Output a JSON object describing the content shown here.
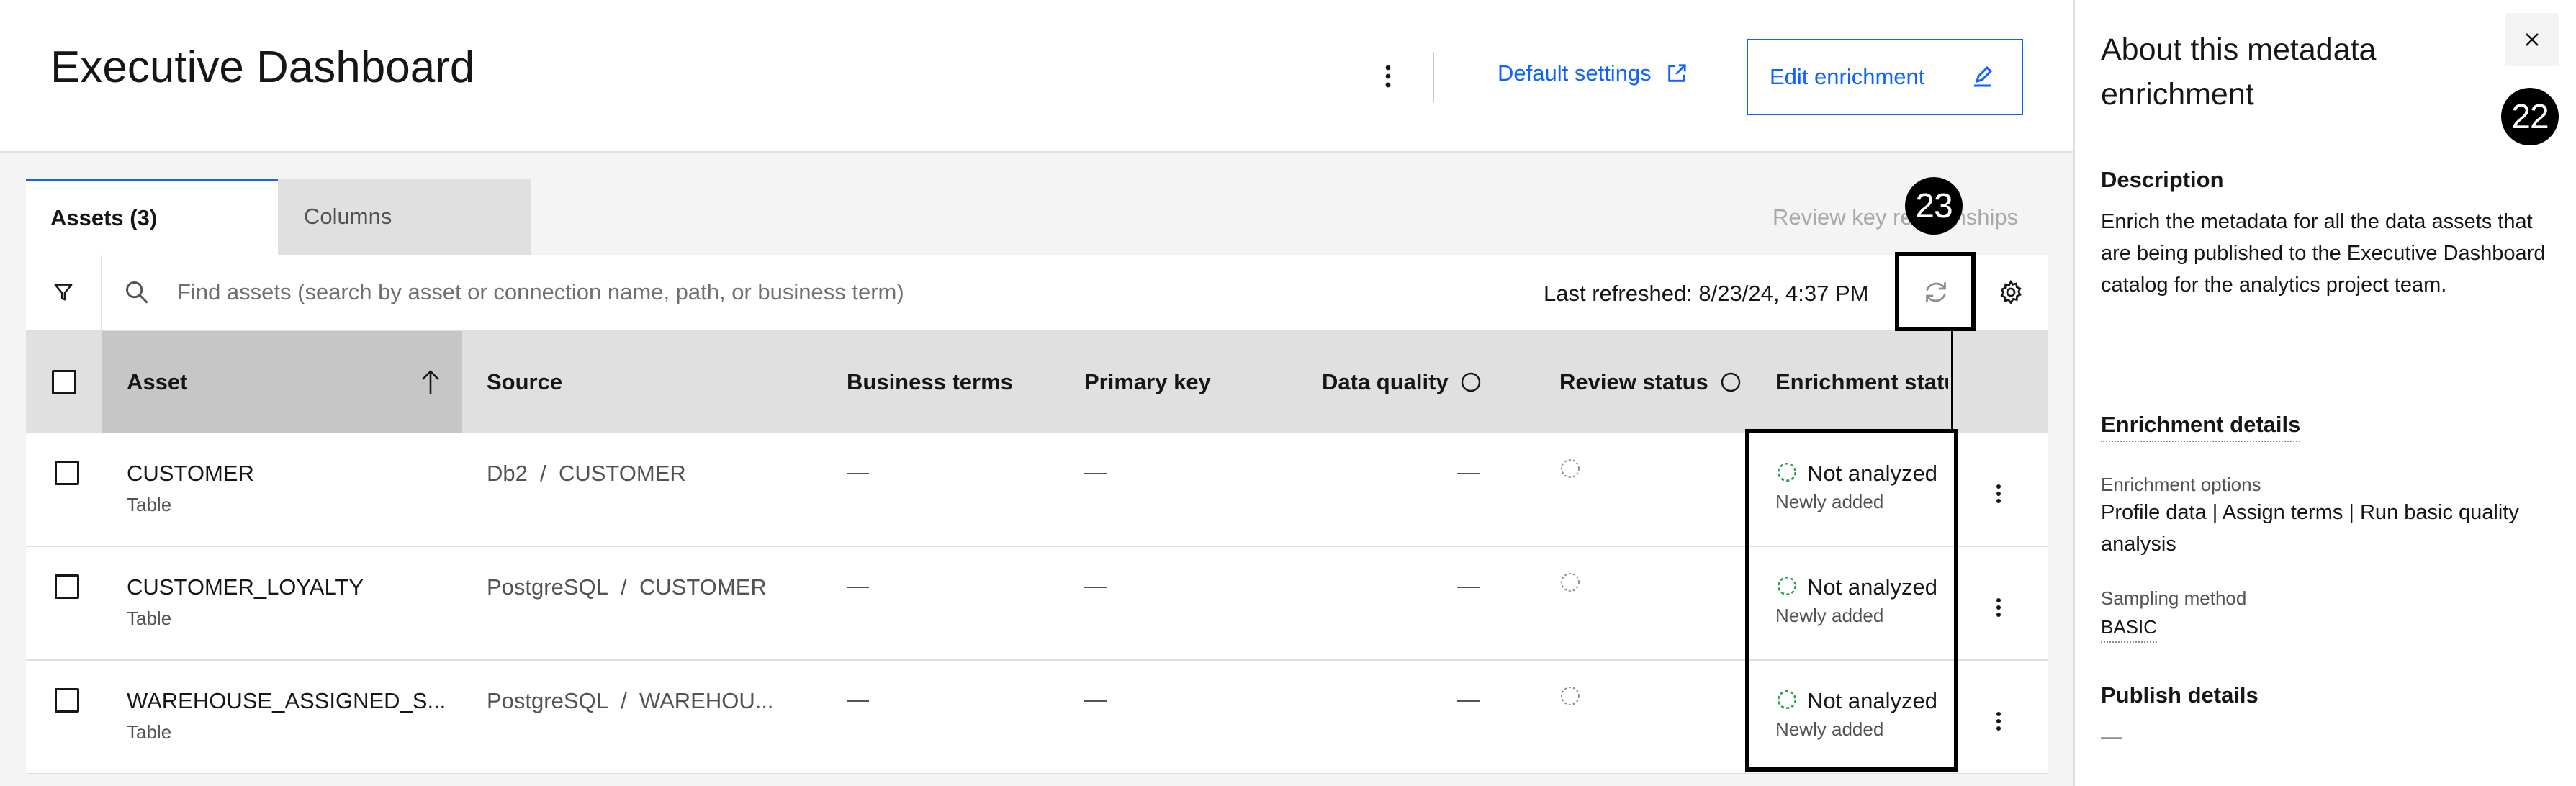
{
  "page": {
    "title": "Executive Dashboard",
    "default_settings_label": "Default settings",
    "edit_enrichment_label": "Edit enrichment"
  },
  "tabs": [
    {
      "label": "Assets (3)",
      "selected": true
    },
    {
      "label": "Columns",
      "selected": false
    }
  ],
  "review_key_relationships_label": "Review key relationships",
  "toolbar": {
    "search_placeholder": "Find assets (search by asset or connection name, path, or business term)",
    "last_refreshed": "Last refreshed: 8/23/24, 4:37 PM"
  },
  "table": {
    "headers": {
      "asset": "Asset",
      "source": "Source",
      "business_terms": "Business terms",
      "primary_key": "Primary key",
      "data_quality": "Data quality",
      "review_status": "Review status",
      "enrichment_status": "Enrichment status"
    },
    "sort": {
      "column": "Asset",
      "direction": "ascending"
    },
    "rows": [
      {
        "name": "CUSTOMER",
        "type": "Table",
        "source_connection": "Db2",
        "source_path": "CUSTOMER",
        "business_terms": "—",
        "primary_key": "—",
        "data_quality": "—",
        "status": "Not analyzed",
        "status_sub": "Newly added"
      },
      {
        "name": "CUSTOMER_LOYALTY",
        "type": "Table",
        "source_connection": "PostgreSQL",
        "source_path": "CUSTOMER",
        "business_terms": "—",
        "primary_key": "—",
        "data_quality": "—",
        "status": "Not analyzed",
        "status_sub": "Newly added"
      },
      {
        "name": "WAREHOUSE_ASSIGNED_S...",
        "type": "Table",
        "source_connection": "PostgreSQL",
        "source_path": "WAREHOU...",
        "business_terms": "—",
        "primary_key": "—",
        "data_quality": "—",
        "status": "Not analyzed",
        "status_sub": "Newly added"
      }
    ],
    "source_separator": "/"
  },
  "annotations": {
    "refresh_badge": "23",
    "panel_badge": "22"
  },
  "panel": {
    "title": "About this metadata enrichment",
    "description_heading": "Description",
    "description": "Enrich the metadata for all the data assets that are being published to the Executive Dashboard catalog for the analytics project team.",
    "enrichment_details_heading": "Enrichment details",
    "enrichment_options_label": "Enrichment options",
    "enrichment_options_value": "Profile data | Assign terms | Run basic quality analysis",
    "sampling_method_label": "Sampling method",
    "sampling_method_value": "BASIC",
    "publish_details_heading": "Publish details",
    "publish_details_value": "—"
  },
  "colors": {
    "accent": "#0f62fe",
    "status_green": "#24a148",
    "annotation": "#000000"
  },
  "icons": [
    "overflow-menu-icon",
    "launch-icon",
    "edit-icon",
    "filter-icon",
    "search-icon",
    "refresh-icon",
    "settings-icon",
    "arrow-up-icon",
    "info-icon",
    "not-analyzed-icon",
    "review-status-icon",
    "close-icon"
  ]
}
